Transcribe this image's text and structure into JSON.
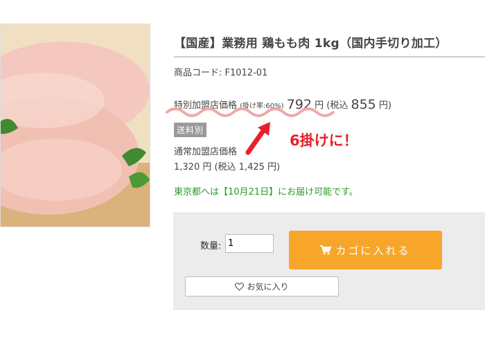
{
  "product": {
    "title": "【国産】業務用 鶏もも肉 1kg（国内手切り加工）",
    "sku": "商品コード: F1012-01"
  },
  "pricing": {
    "special_label": "特別加盟店価格",
    "rate_text": "(掛け率:60%)",
    "special_price": "792",
    "yen": "円",
    "tax_open": "(税込",
    "tax_price": "855",
    "tax_close": "円)",
    "free_shipping": "送料別",
    "callout": "6掛けに！",
    "normal_label": "通常加盟店価格",
    "normal_price": "1,320 円 (税込 1,425 円)"
  },
  "delivery_text": "東京都へは【10月21日】にお届け可能です。",
  "cart": {
    "qty_label": "数量:",
    "qty_value": "1",
    "add_to_cart": "カゴに入れる",
    "favorite": "お気に入り"
  },
  "colors": {
    "accent_orange": "#f8a62a",
    "callout_red": "#e8202a",
    "delivery_green": "#2b9a2b"
  },
  "icons": [
    "cart-icon",
    "heart-icon",
    "wavy-underline",
    "red-arrow"
  ]
}
